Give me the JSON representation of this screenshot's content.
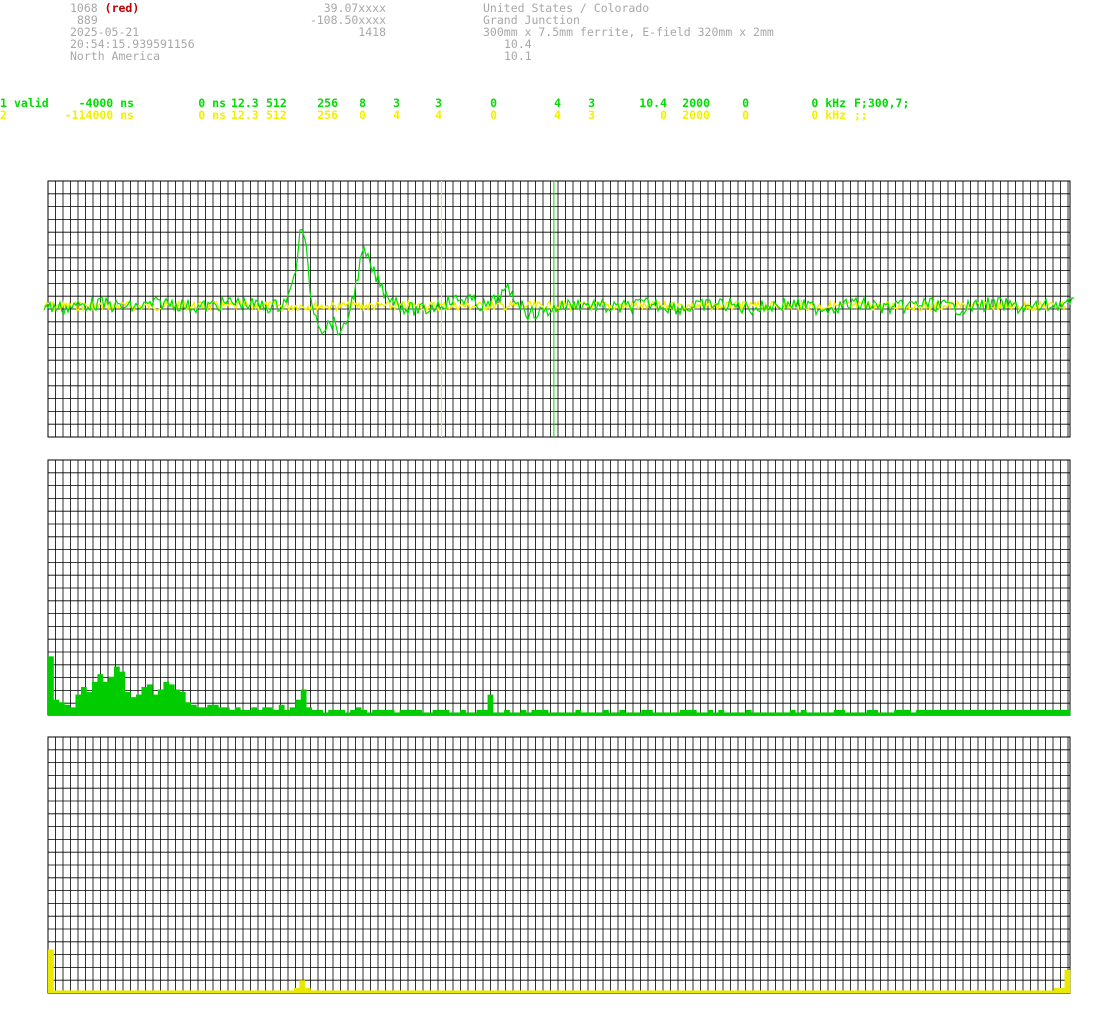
{
  "header": {
    "station_id": "1068",
    "station_tag": "(red)",
    "station_num": "889",
    "date": "2025-05-21",
    "time": "20:54:15.939591156",
    "continent": "North America",
    "lat": "39.07xxxx",
    "lon": "-108.50xxxx",
    "alt": "1418",
    "country": "United States / Colorado",
    "city": "Grand Junction",
    "antenna": "300mm x 7.5mm ferrite, E-field 320mm x 2mm",
    "val1": "10.4",
    "val2": "10.1"
  },
  "channels": [
    {
      "c1": "1",
      "c2": "valid",
      "c3": "-4000 ns",
      "c4": "0 ns",
      "c5": "12.3",
      "c6": "512",
      "c7": "256",
      "c8": "8",
      "c9": "3",
      "c10": "3",
      "c11": "0",
      "c12": "4",
      "c13": "3",
      "c14": "10.4",
      "c15": "2000",
      "c16": "0",
      "c17": "0 kHz",
      "c18": "F;300,7;",
      "color": "#00dd00"
    },
    {
      "c1": "2",
      "c2": "",
      "c3": "-114000 ns",
      "c4": "0 ns",
      "c5": "12.3",
      "c6": "512",
      "c7": "256",
      "c8": "0",
      "c9": "4",
      "c10": "4",
      "c11": "0",
      "c12": "4",
      "c13": "3",
      "c14": "0",
      "c15": "2000",
      "c16": "0",
      "c17": "0 kHz",
      "c18": ";;",
      "color": "#f0f000"
    }
  ],
  "chart_data": [
    {
      "type": "line",
      "series": [
        {
          "color": "#00dd00",
          "markers": {
            "t": [
              0,
              0.23,
              0.24,
              0.245,
              0.25,
              0.255,
              0.26,
              0.27,
              0.28,
              0.29,
              0.3,
              0.31,
              0.32,
              0.33,
              0.34,
              0.35,
              0.37,
              0.39,
              0.41,
              0.43,
              0.45,
              0.47,
              0.5
            ],
            "y": [
              0,
              0.02,
              0.15,
              0.45,
              0.9,
              0.55,
              0.0,
              -0.25,
              -0.15,
              -0.3,
              0.1,
              0.6,
              0.35,
              0.15,
              0.08,
              0.0,
              -0.05,
              0.02,
              0.1,
              0.0,
              0.15,
              -0.08,
              0
            ]
          }
        },
        {
          "color": "#f0f000"
        }
      ],
      "markers": [
        {
          "color": "#f0f000",
          "pos": 0.385
        },
        {
          "color": "#00dd00",
          "pos": 0.495
        }
      ]
    },
    {
      "type": "bar",
      "color": "#00cc00",
      "values": [
        0.23,
        0.06,
        0.05,
        0.04,
        0.03,
        0.08,
        0.11,
        0.09,
        0.13,
        0.16,
        0.13,
        0.15,
        0.19,
        0.17,
        0.09,
        0.07,
        0.08,
        0.11,
        0.12,
        0.08,
        0.1,
        0.13,
        0.12,
        0.1,
        0.09,
        0.05,
        0.04,
        0.03,
        0.03,
        0.04,
        0.04,
        0.03,
        0.03,
        0.02,
        0.03,
        0.02,
        0.02,
        0.03,
        0.02,
        0.03,
        0.03,
        0.02,
        0.04,
        0.02,
        0.03,
        0.06,
        0.1,
        0.03,
        0.02,
        0.02,
        0.01,
        0.02,
        0.02,
        0.02,
        0.01,
        0.02,
        0.03,
        0.02,
        0.01,
        0.02,
        0.02,
        0.02,
        0.02,
        0.01,
        0.02,
        0.02,
        0.02,
        0.02,
        0.01,
        0.01,
        0.02,
        0.02,
        0.02,
        0.01,
        0.01,
        0.02,
        0.01,
        0.01,
        0.02,
        0.02,
        0.08,
        0.01,
        0.01,
        0.02,
        0.01,
        0.01,
        0.02,
        0.01,
        0.02,
        0.02,
        0.02,
        0.01,
        0.01,
        0.01,
        0.01,
        0.01,
        0.02,
        0.01,
        0.01,
        0.01,
        0.01,
        0.02,
        0.01,
        0.01,
        0.02,
        0.01,
        0.01,
        0.01,
        0.02,
        0.02,
        0.01,
        0.01,
        0.01,
        0.01,
        0.01,
        0.02,
        0.02,
        0.02,
        0.01,
        0.01,
        0.02,
        0.01,
        0.02,
        0.01,
        0.01,
        0.01,
        0.01,
        0.02,
        0.01,
        0.01,
        0.01,
        0.01,
        0.01,
        0.01,
        0.01,
        0.02,
        0.01,
        0.02,
        0.01,
        0.01,
        0.01,
        0.01,
        0.01,
        0.02,
        0.02,
        0.01,
        0.01,
        0.01,
        0.01,
        0.02,
        0.02,
        0.01,
        0.01,
        0.01,
        0.02,
        0.02,
        0.02,
        0.01,
        0.02,
        0.02,
        0.02,
        0.02,
        0.02,
        0.02,
        0.02,
        0.02,
        0.02,
        0.02,
        0.02,
        0.02,
        0.02,
        0.02,
        0.02,
        0.02,
        0.02,
        0.02,
        0.02,
        0.02,
        0.02,
        0.02,
        0.02,
        0.02,
        0.02,
        0.02,
        0.02,
        0.02
      ]
    },
    {
      "type": "bar",
      "color": "#e8e800",
      "values": [
        0.17,
        0.01,
        0.01,
        0.01,
        0.01,
        0.01,
        0.01,
        0.01,
        0.01,
        0.01,
        0.01,
        0.01,
        0.01,
        0.01,
        0.01,
        0.01,
        0.01,
        0.01,
        0.01,
        0.01,
        0.01,
        0.01,
        0.01,
        0.01,
        0.01,
        0.01,
        0.01,
        0.01,
        0.01,
        0.01,
        0.01,
        0.01,
        0.01,
        0.01,
        0.01,
        0.01,
        0.01,
        0.01,
        0.01,
        0.01,
        0.01,
        0.01,
        0.01,
        0.01,
        0.01,
        0.02,
        0.05,
        0.02,
        0.01,
        0.01,
        0.01,
        0.01,
        0.01,
        0.01,
        0.01,
        0.01,
        0.01,
        0.01,
        0.01,
        0.01,
        0.01,
        0.01,
        0.01,
        0.01,
        0.01,
        0.01,
        0.01,
        0.01,
        0.01,
        0.01,
        0.01,
        0.01,
        0.01,
        0.01,
        0.01,
        0.01,
        0.01,
        0.01,
        0.01,
        0.01,
        0.01,
        0.01,
        0.01,
        0.01,
        0.01,
        0.01,
        0.01,
        0.01,
        0.01,
        0.01,
        0.01,
        0.01,
        0.01,
        0.01,
        0.01,
        0.01,
        0.01,
        0.01,
        0.01,
        0.01,
        0.01,
        0.01,
        0.01,
        0.01,
        0.01,
        0.01,
        0.01,
        0.01,
        0.01,
        0.01,
        0.01,
        0.01,
        0.01,
        0.01,
        0.01,
        0.01,
        0.01,
        0.01,
        0.01,
        0.01,
        0.01,
        0.01,
        0.01,
        0.01,
        0.01,
        0.01,
        0.01,
        0.01,
        0.01,
        0.01,
        0.01,
        0.01,
        0.01,
        0.01,
        0.01,
        0.01,
        0.01,
        0.01,
        0.01,
        0.01,
        0.01,
        0.01,
        0.01,
        0.01,
        0.01,
        0.01,
        0.01,
        0.01,
        0.01,
        0.01,
        0.01,
        0.01,
        0.01,
        0.01,
        0.01,
        0.01,
        0.01,
        0.01,
        0.01,
        0.01,
        0.01,
        0.01,
        0.01,
        0.01,
        0.01,
        0.01,
        0.01,
        0.01,
        0.01,
        0.01,
        0.01,
        0.01,
        0.01,
        0.01,
        0.01,
        0.01,
        0.01,
        0.01,
        0.01,
        0.01,
        0.01,
        0.01,
        0.01,
        0.01,
        0.02,
        0.02,
        0.09
      ]
    }
  ]
}
